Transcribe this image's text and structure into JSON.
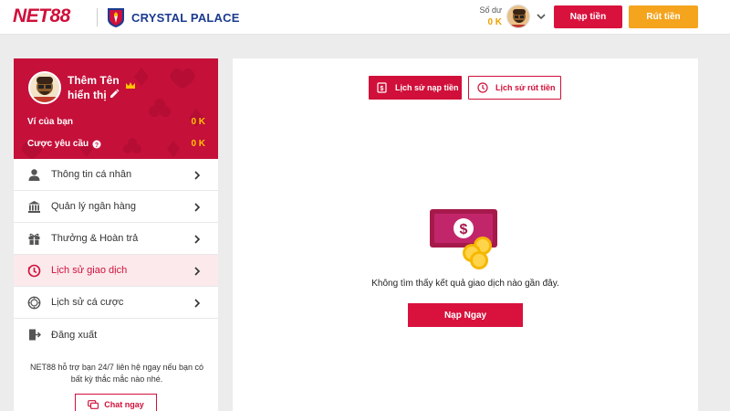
{
  "header": {
    "logo_text": "NET88",
    "club_name": "CRYSTAL PALACE",
    "balance_label": "Số dư",
    "balance_value": "0 K",
    "deposit_button": "Nạp tiền",
    "withdraw_button": "Rút tiền"
  },
  "profile": {
    "display_name": "Thêm Tên hiển thị",
    "wallet_label": "Ví của bạn",
    "wallet_value": "0 K",
    "bet_requirement_label": "Cược yêu cầu",
    "bet_requirement_value": "0 K"
  },
  "menu": {
    "items": [
      {
        "label": "Thông tin cá nhân",
        "icon": "user-icon"
      },
      {
        "label": "Quản lý ngân hàng",
        "icon": "bank-icon"
      },
      {
        "label": "Thưởng & Hoàn trả",
        "icon": "gift-icon"
      },
      {
        "label": "Lịch sử giao dịch",
        "icon": "transaction-history-icon",
        "active": true
      },
      {
        "label": "Lịch sử cá cược",
        "icon": "bet-history-icon"
      },
      {
        "label": "Đăng xuất",
        "icon": "logout-icon"
      }
    ]
  },
  "support": {
    "text": "NET88 hỗ trợ bạn 24/7 liên hệ ngay nếu bạn có bất kỳ thắc mắc nào nhé.",
    "chat_button": "Chat ngay"
  },
  "main": {
    "tabs": [
      {
        "label": "Lịch sử nạp tiền",
        "active": true
      },
      {
        "label": "Lịch sử rút tiền",
        "active": false
      }
    ],
    "empty_message": "Không tìm thấy kết quả giao dịch nào gần đây.",
    "deposit_now_button": "Nạp Ngay"
  },
  "colors": {
    "brand_red": "#d0103a",
    "accent_orange": "#f5a41e",
    "gold": "#ffc400",
    "club_blue": "#1b3b8f"
  }
}
